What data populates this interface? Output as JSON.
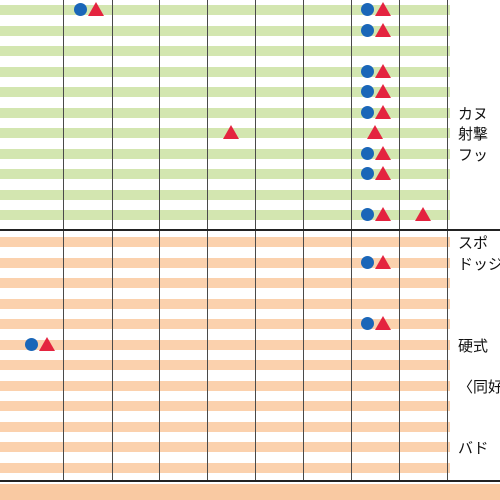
{
  "colors": {
    "green_stripe": "#d3e6b0",
    "orange_stripe": "#fbd1ad",
    "circle_mark": "#1a66b8",
    "triangle_mark": "#e4243f"
  },
  "sections": [
    {
      "name": "green-section",
      "color": "green",
      "rows": 11
    },
    {
      "name": "orange-section",
      "color": "orange",
      "rows": 12
    }
  ],
  "column_count": 9,
  "row_labels": [
    {
      "text": "カヌ",
      "row": 5
    },
    {
      "text": "射撃",
      "row": 6
    },
    {
      "text": "フッ",
      "row": 7
    },
    {
      "text": "スポ",
      "row": 11
    },
    {
      "text": "ドッジ",
      "row": 12
    },
    {
      "text": "硬式",
      "row": 16
    },
    {
      "text": "〈同好",
      "row": 18
    },
    {
      "text": "バド",
      "row": 21
    }
  ],
  "marks": [
    {
      "row": 0,
      "col": 1,
      "circle": true,
      "triangle": true
    },
    {
      "row": 0,
      "col": 7,
      "circle": true,
      "triangle": true
    },
    {
      "row": 1,
      "col": 7,
      "circle": true,
      "triangle": true
    },
    {
      "row": 3,
      "col": 7,
      "circle": true,
      "triangle": true
    },
    {
      "row": 4,
      "col": 7,
      "circle": true,
      "triangle": true
    },
    {
      "row": 5,
      "col": 7,
      "circle": true,
      "triangle": true
    },
    {
      "row": 6,
      "col": 4,
      "circle": false,
      "triangle": true
    },
    {
      "row": 6,
      "col": 7,
      "circle": false,
      "triangle": true
    },
    {
      "row": 7,
      "col": 7,
      "circle": true,
      "triangle": true
    },
    {
      "row": 8,
      "col": 7,
      "circle": true,
      "triangle": true
    },
    {
      "row": 10,
      "col": 7,
      "circle": true,
      "triangle": true
    },
    {
      "row": 10,
      "col": 8,
      "circle": false,
      "triangle": true
    },
    {
      "row": 12,
      "col": 7,
      "circle": true,
      "triangle": true
    },
    {
      "row": 15,
      "col": 7,
      "circle": true,
      "triangle": true
    },
    {
      "row": 16,
      "col": 0,
      "circle": true,
      "triangle": true
    }
  ]
}
